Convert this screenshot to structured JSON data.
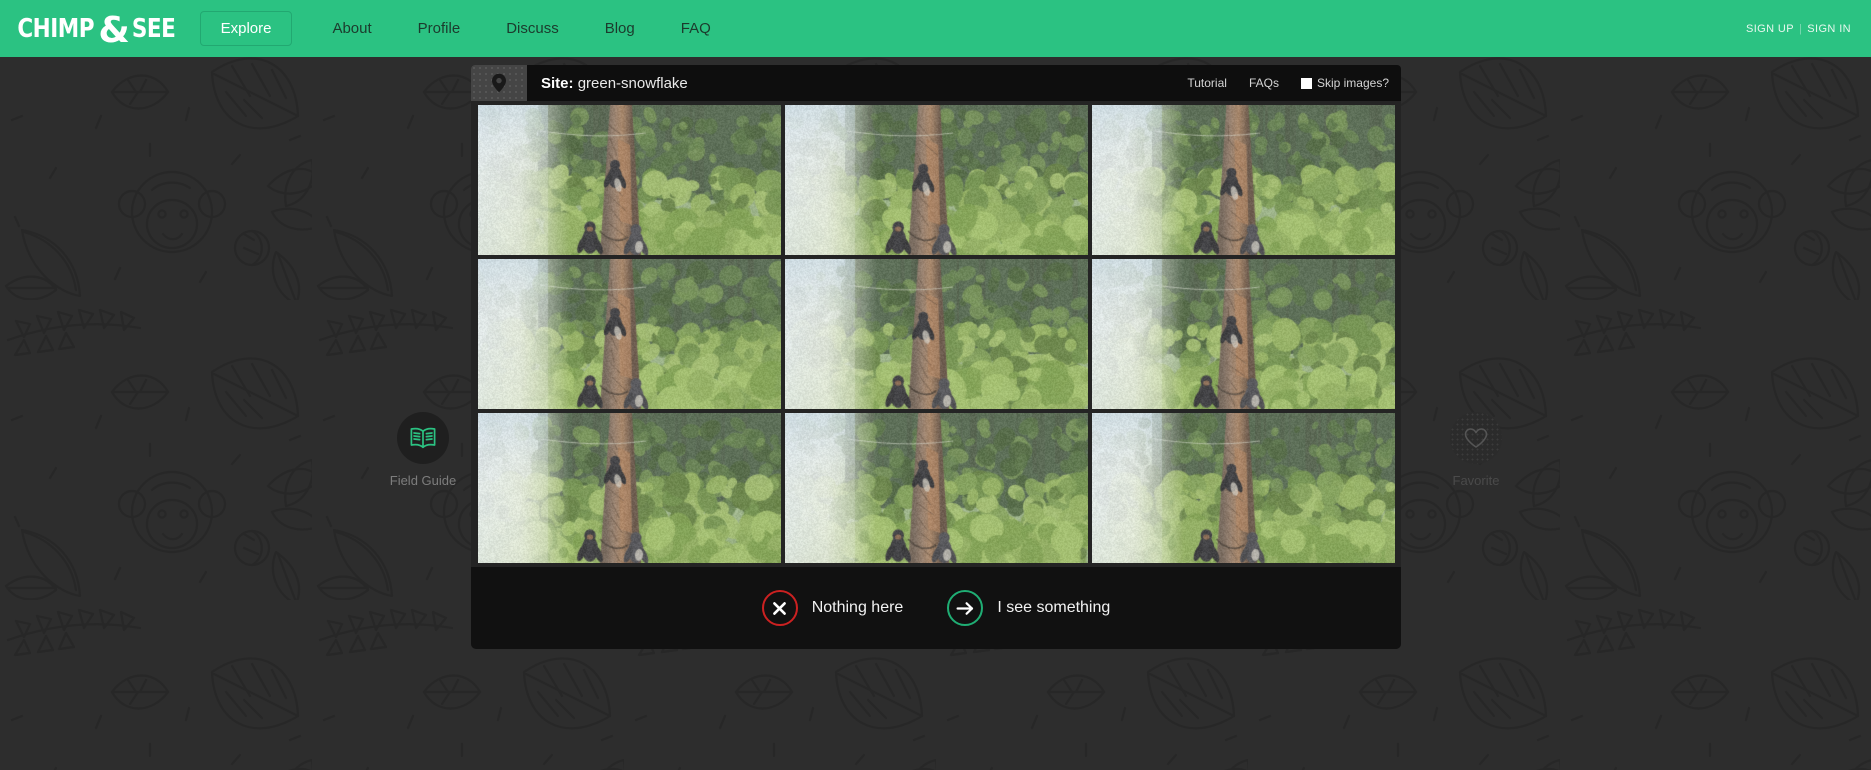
{
  "header": {
    "logo": {
      "part1": "CHIMP",
      "amp": "&",
      "part2": "SEE"
    },
    "nav": [
      {
        "label": "Explore",
        "active": true
      },
      {
        "label": "About",
        "active": false
      },
      {
        "label": "Profile",
        "active": false
      },
      {
        "label": "Discuss",
        "active": false
      },
      {
        "label": "Blog",
        "active": false
      },
      {
        "label": "FAQ",
        "active": false
      }
    ],
    "auth": {
      "sign_up": "SIGN UP",
      "separator": "|",
      "sign_in": "SIGN IN"
    },
    "accent_color": "#2bc282"
  },
  "classifier": {
    "site_label": "Site:",
    "site_name": "green-snowflake",
    "pin_icon": "location-pin-icon",
    "tools": {
      "tutorial": "Tutorial",
      "faqs": "FAQs",
      "skip_images": "Skip images?",
      "skip_images_checked": false
    },
    "frames": [
      {
        "index": 1,
        "alt": "camera trap frame"
      },
      {
        "index": 2,
        "alt": "camera trap frame"
      },
      {
        "index": 3,
        "alt": "camera trap frame"
      },
      {
        "index": 4,
        "alt": "camera trap frame"
      },
      {
        "index": 5,
        "alt": "camera trap frame"
      },
      {
        "index": 6,
        "alt": "camera trap frame"
      },
      {
        "index": 7,
        "alt": "camera trap frame"
      },
      {
        "index": 8,
        "alt": "camera trap frame"
      },
      {
        "index": 9,
        "alt": "camera trap frame"
      }
    ],
    "actions": {
      "nothing_here": "Nothing here",
      "nothing_here_icon": "x-icon",
      "nothing_here_color": "#cc2121",
      "i_see_something": "I see something",
      "i_see_something_icon": "arrow-right-icon",
      "i_see_something_color": "#1fae74"
    }
  },
  "side": {
    "field_guide": {
      "label": "Field Guide",
      "icon": "open-book-icon",
      "color": "#2bc282"
    },
    "favorite": {
      "label": "Favorite",
      "icon": "heart-icon",
      "disabled": true
    }
  }
}
